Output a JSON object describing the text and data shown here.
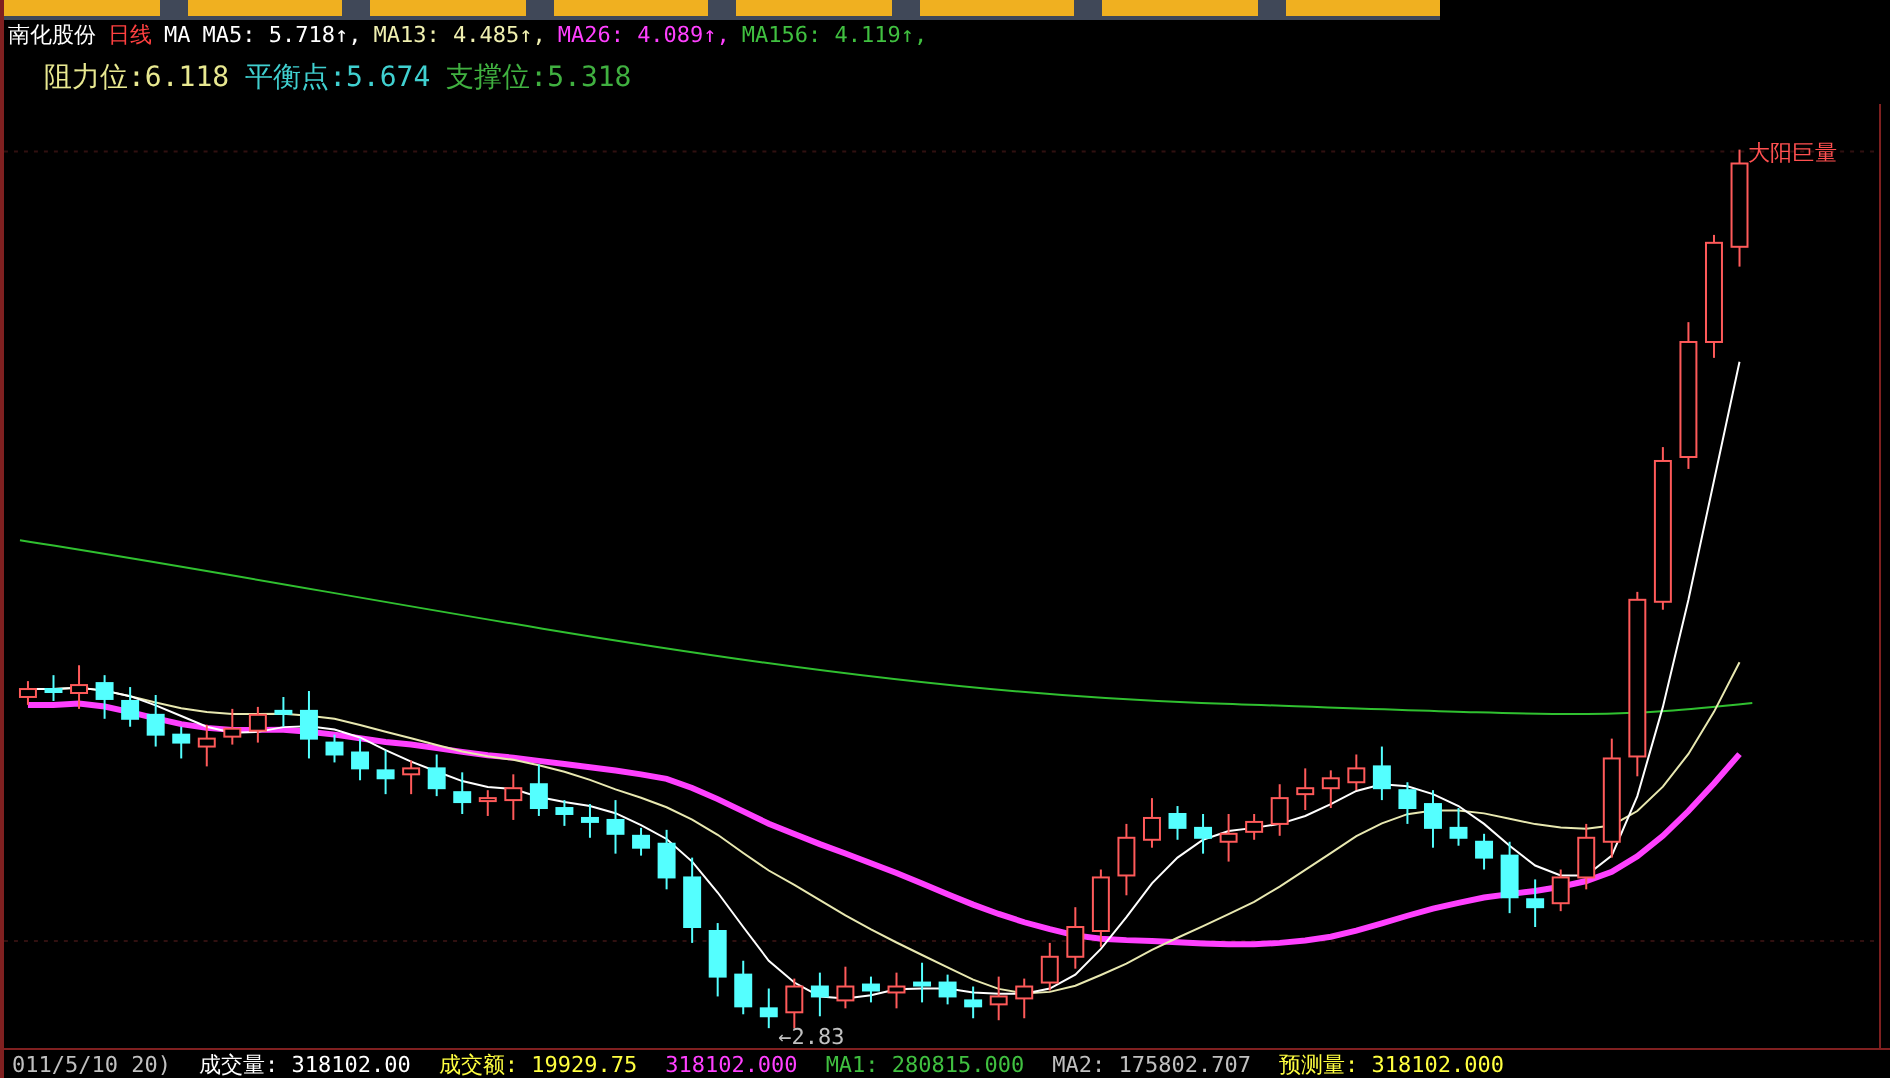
{
  "header": {
    "name": "南化股份",
    "period": "日线",
    "indicator": "MA",
    "ma_values": [
      {
        "text": "MA5: 5.718↑,",
        "color": "#ffffff"
      },
      {
        "text": "MA13: 4.485↑,",
        "color": "#f0f0b0"
      },
      {
        "text": "MA26: 4.089↑,",
        "color": "#ff40ff"
      },
      {
        "text": "MA156: 4.119↑,",
        "color": "#40c040"
      }
    ]
  },
  "levels": [
    {
      "text": "阻力位:6.118",
      "color": "#e8e890"
    },
    {
      "text": "平衡点:5.674",
      "color": "#40d0d0"
    },
    {
      "text": "支撑位:5.318",
      "color": "#40b040"
    }
  ],
  "chart": {
    "low_label": "←2.83",
    "callout": "大阳巨量"
  },
  "volume_bar": [
    {
      "text": "011/5/10 20)",
      "color": "#c0c0c0"
    },
    {
      "text": "成交量: 318102.00",
      "color": "#ffffff"
    },
    {
      "text": "成交额: 19929.75",
      "color": "#ffff40"
    },
    {
      "text": "318102.000",
      "color": "#ff40ff"
    },
    {
      "text": "MA1: 280815.000",
      "color": "#40c040"
    },
    {
      "text": "MA2: 175802.707",
      "color": "#c0c0c0"
    },
    {
      "text": "预测量: 318102.000",
      "color": "#ffff40"
    }
  ]
}
